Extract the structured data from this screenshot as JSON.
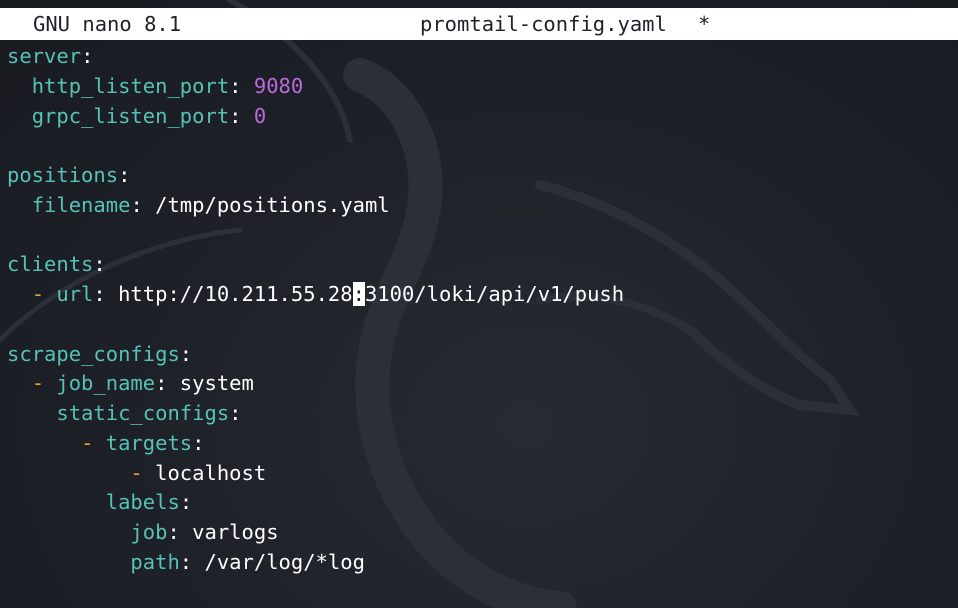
{
  "titlebar": {
    "app": "GNU nano 8.1",
    "filename": "promtail-config.yaml",
    "modified_marker": "*"
  },
  "editor": {
    "lines": [
      {
        "indent": "",
        "dash": "",
        "key": "server",
        "value": ""
      },
      {
        "indent": "  ",
        "dash": "",
        "key": "http_listen_port",
        "value": "9080"
      },
      {
        "indent": "  ",
        "dash": "",
        "key": "grpc_listen_port",
        "value": "0"
      },
      {
        "indent": "",
        "dash": "",
        "key": "",
        "value": ""
      },
      {
        "indent": "",
        "dash": "",
        "key": "positions",
        "value": ""
      },
      {
        "indent": "  ",
        "dash": "",
        "key": "filename",
        "value": "/tmp/positions.yaml"
      },
      {
        "indent": "",
        "dash": "",
        "key": "",
        "value": ""
      },
      {
        "indent": "",
        "dash": "",
        "key": "clients",
        "value": ""
      },
      {
        "indent": "  ",
        "dash": "- ",
        "key": "url",
        "value_before_cursor": "http://10.211.55.28",
        "cursor_char": ":",
        "value_after_cursor": "3100/loki/api/v1/push"
      },
      {
        "indent": "",
        "dash": "",
        "key": "",
        "value": ""
      },
      {
        "indent": "",
        "dash": "",
        "key": "scrape_configs",
        "value": ""
      },
      {
        "indent": "  ",
        "dash": "- ",
        "key": "job_name",
        "value": "system"
      },
      {
        "indent": "    ",
        "dash": "",
        "key": "static_configs",
        "value": ""
      },
      {
        "indent": "      ",
        "dash": "- ",
        "key": "targets",
        "value": ""
      },
      {
        "indent": "          ",
        "dash": "- ",
        "key": "",
        "value": "localhost"
      },
      {
        "indent": "        ",
        "dash": "",
        "key": "labels",
        "value": ""
      },
      {
        "indent": "          ",
        "dash": "",
        "key": "job",
        "value": "varlogs"
      },
      {
        "indent": "          ",
        "dash": "",
        "key": "path",
        "value": "/var/log/*log"
      }
    ]
  },
  "colors": {
    "key": "#56c2b5",
    "number": "#b86bd9",
    "dash": "#f0a030",
    "text": "#ffffff",
    "background": "#1e2229",
    "titlebar_bg": "#ffffff"
  }
}
